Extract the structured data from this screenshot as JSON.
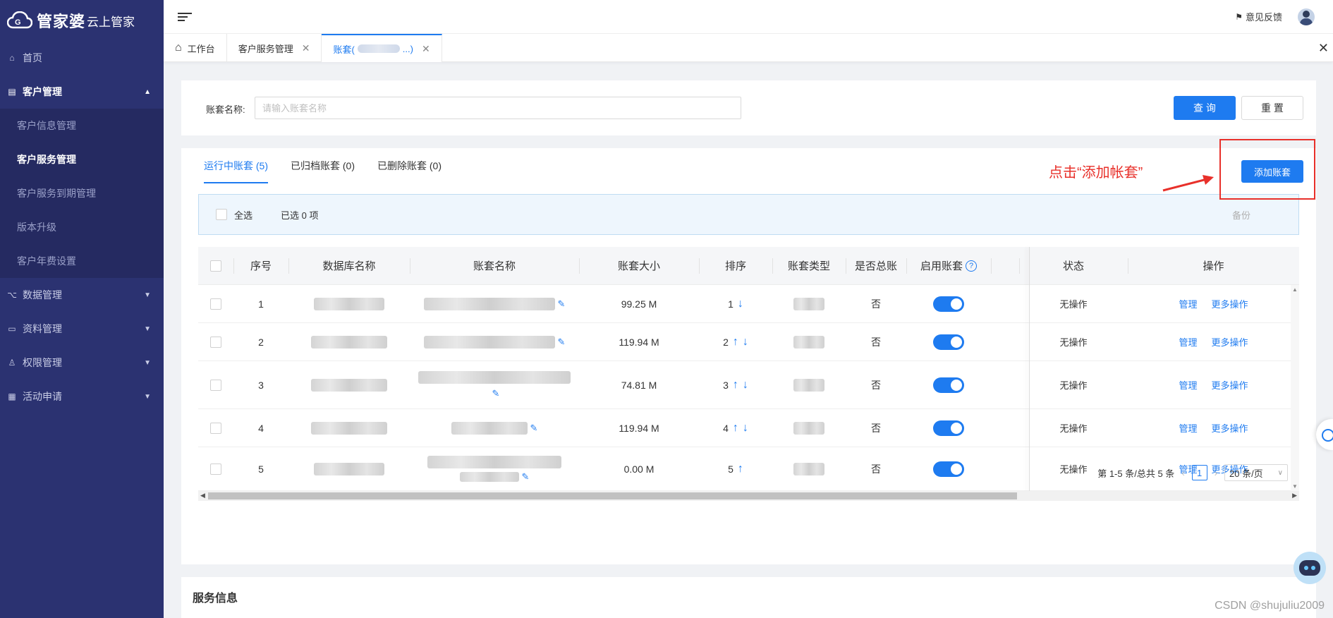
{
  "app": {
    "brand": "管家婆",
    "brand_sub": "云上管家"
  },
  "sidebar": {
    "items": [
      {
        "label": "首页"
      },
      {
        "label": "客户管理"
      },
      {
        "label": "数据管理"
      },
      {
        "label": "资料管理"
      },
      {
        "label": "权限管理"
      },
      {
        "label": "活动申请"
      }
    ],
    "customer_sub": [
      {
        "label": "客户信息管理"
      },
      {
        "label": "客户服务管理"
      },
      {
        "label": "客户服务到期管理"
      },
      {
        "label": "版本升级"
      },
      {
        "label": "客户年费设置"
      }
    ]
  },
  "topbar": {
    "feedback": "意见反馈"
  },
  "tabs": [
    {
      "label": "工作台"
    },
    {
      "label": "客户服务管理"
    },
    {
      "label_prefix": "账套(",
      "label_suffix": "...)"
    }
  ],
  "search": {
    "label": "账套名称:",
    "placeholder": "请输入账套名称",
    "query": "查 询",
    "reset": "重 置"
  },
  "subtabs": [
    {
      "label": "运行中账套 (5)"
    },
    {
      "label": "已归档账套 (0)"
    },
    {
      "label": "已删除账套 (0)"
    }
  ],
  "add_button": "添加账套",
  "annotation": "点击“添加帐套”",
  "selectbar": {
    "select_all": "全选",
    "selected": "已选 0 项",
    "backup": "备份"
  },
  "table": {
    "headers": {
      "seq": "序号",
      "db": "数据库名称",
      "name": "账套名称",
      "size": "账套大小",
      "sort": "排序",
      "type": "账套类型",
      "total": "是否总账",
      "enable": "启用账套",
      "status": "状态",
      "ops": "操作"
    },
    "rows": [
      {
        "seq": "1",
        "size": "99.25 M",
        "sort": "1",
        "total": "否",
        "status": "无操作",
        "manage": "管理",
        "more": "更多操作"
      },
      {
        "seq": "2",
        "size": "119.94 M",
        "sort": "2",
        "total": "否",
        "status": "无操作",
        "manage": "管理",
        "more": "更多操作"
      },
      {
        "seq": "3",
        "size": "74.81 M",
        "sort": "3",
        "total": "否",
        "status": "无操作",
        "manage": "管理",
        "more": "更多操作"
      },
      {
        "seq": "4",
        "size": "119.94 M",
        "sort": "4",
        "total": "否",
        "status": "无操作",
        "manage": "管理",
        "more": "更多操作"
      },
      {
        "seq": "5",
        "size": "0.00 M",
        "sort": "5",
        "total": "否",
        "status": "无操作",
        "manage": "管理",
        "more": "更多操作"
      }
    ]
  },
  "pagination": {
    "summary": "第 1-5 条/总共 5 条",
    "current": "1",
    "page_size": "20 条/页"
  },
  "service_info": "服务信息",
  "watermark": "CSDN @shujuliu2009",
  "colors": {
    "primary": "#1e7bf0",
    "sidebar": "#2b3271",
    "annotation": "#e8302a"
  }
}
